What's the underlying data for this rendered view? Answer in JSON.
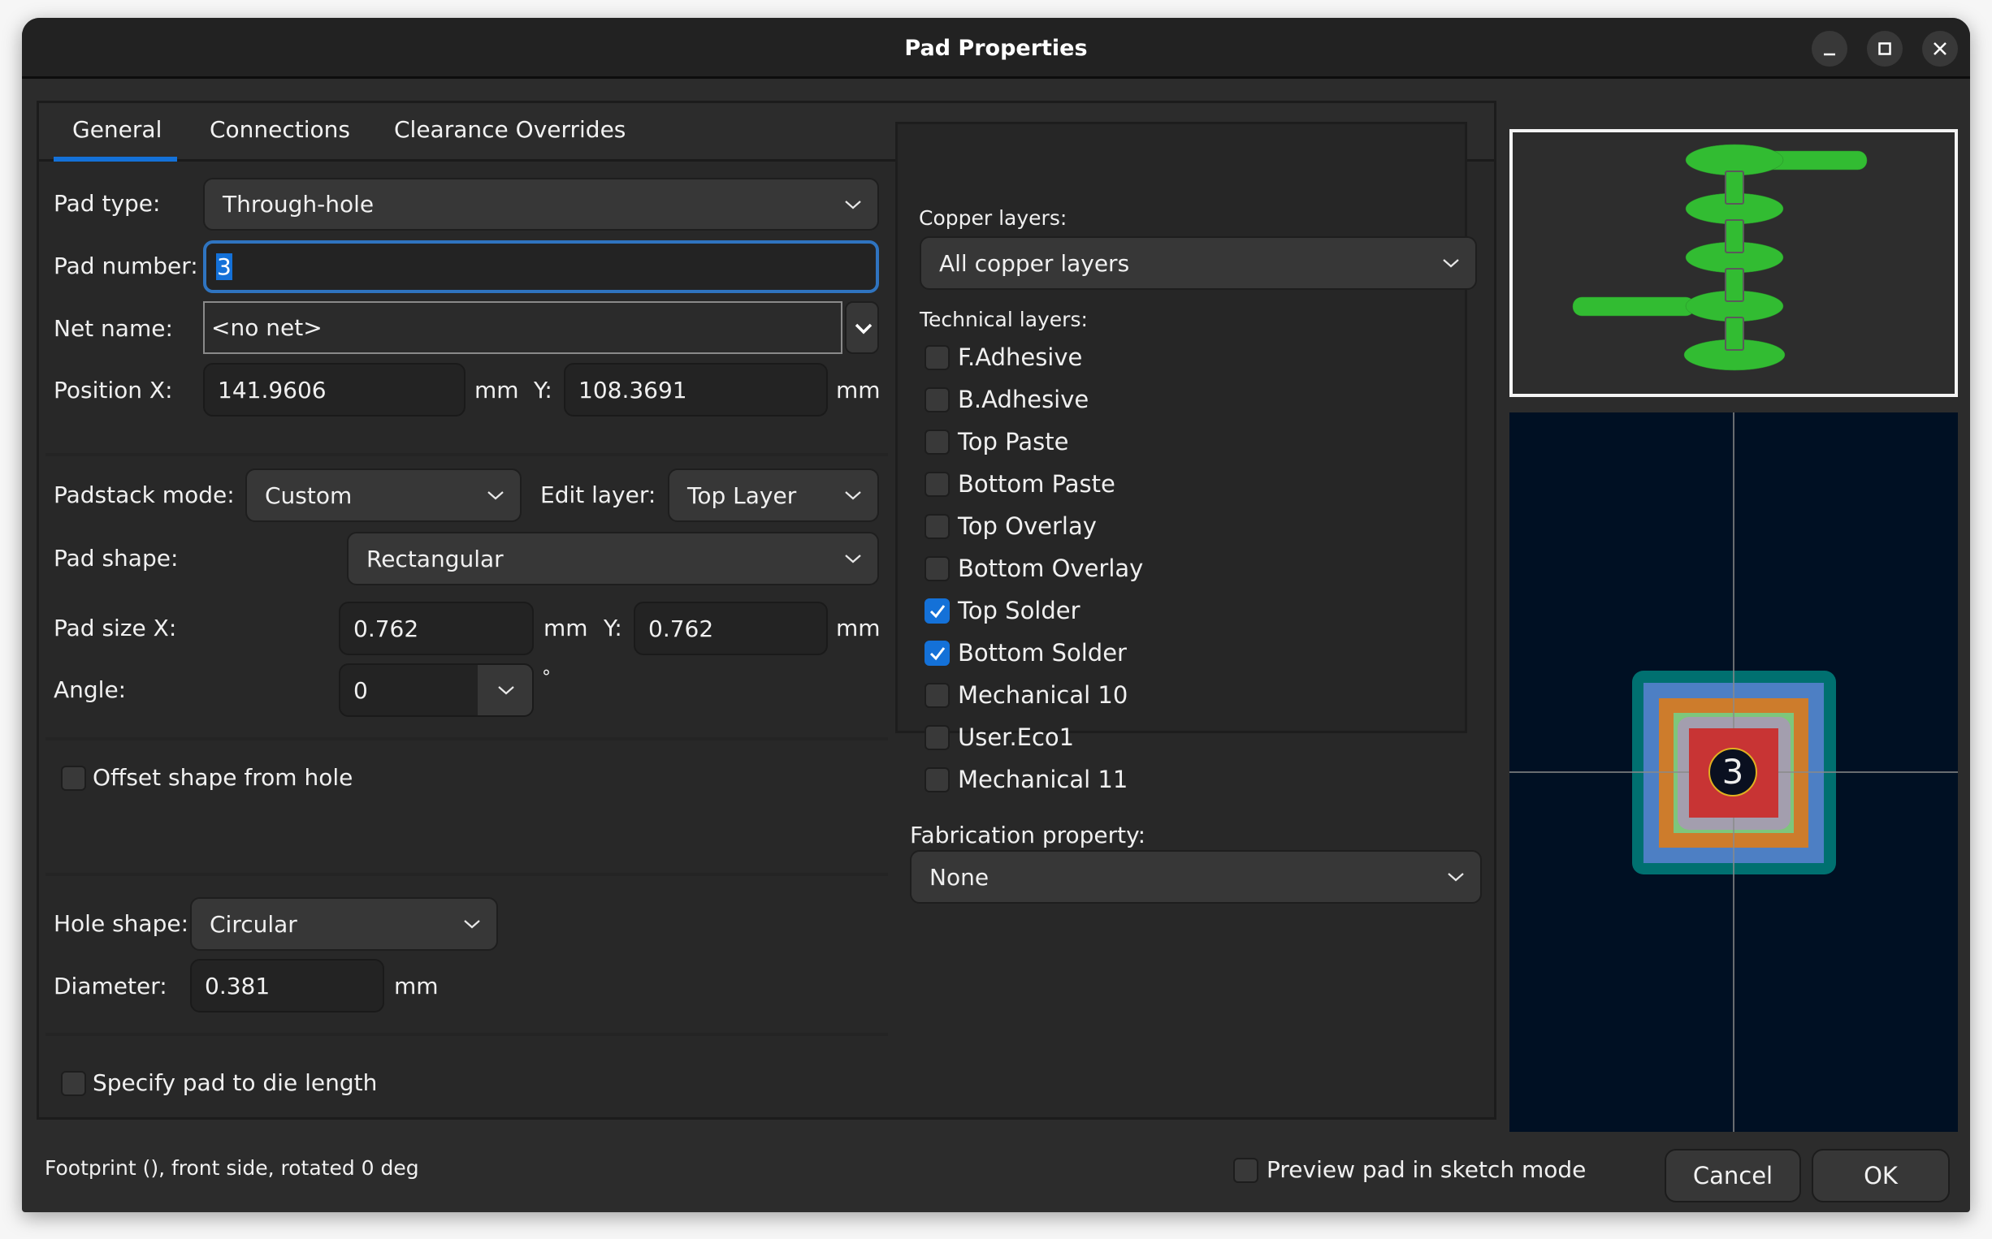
{
  "window": {
    "title": "Pad Properties",
    "controls": {
      "minimize": "minimize-icon",
      "maximize": "maximize-icon",
      "close": "close-icon"
    }
  },
  "tabs": [
    {
      "label": "General",
      "active": true
    },
    {
      "label": "Connections",
      "active": false
    },
    {
      "label": "Clearance Overrides",
      "active": false
    }
  ],
  "general": {
    "pad_type": {
      "label": "Pad type:",
      "value": "Through-hole"
    },
    "pad_number": {
      "label": "Pad number:",
      "value": "3"
    },
    "net_name": {
      "label": "Net name:",
      "value": "<no net>"
    },
    "position": {
      "label_x": "Position X:",
      "x": "141.9606",
      "unit_x": "mm",
      "label_y": "Y:",
      "y": "108.3691",
      "unit_y": "mm"
    },
    "padstack_mode": {
      "label": "Padstack mode:",
      "value": "Custom"
    },
    "edit_layer": {
      "label": "Edit layer:",
      "value": "Top Layer"
    },
    "pad_shape": {
      "label": "Pad shape:",
      "value": "Rectangular"
    },
    "pad_size": {
      "label_x": "Pad size X:",
      "x": "0.762",
      "unit_x": "mm",
      "label_y": "Y:",
      "y": "0.762",
      "unit_y": "mm"
    },
    "angle": {
      "label": "Angle:",
      "value": "0",
      "unit": "°"
    },
    "offset_shape": {
      "label": "Offset shape from hole",
      "checked": false
    },
    "hole_shape": {
      "label": "Hole shape:",
      "value": "Circular"
    },
    "diameter": {
      "label": "Diameter:",
      "value": "0.381",
      "unit": "mm"
    },
    "pad_to_die": {
      "label": "Specify pad to die length",
      "checked": false
    }
  },
  "layers": {
    "copper_label": "Copper layers:",
    "copper_value": "All copper layers",
    "technical_label": "Technical layers:",
    "technical": [
      {
        "label": "F.Adhesive",
        "checked": false
      },
      {
        "label": "B.Adhesive",
        "checked": false
      },
      {
        "label": "Top Paste",
        "checked": false
      },
      {
        "label": "Bottom Paste",
        "checked": false
      },
      {
        "label": "Top Overlay",
        "checked": false
      },
      {
        "label": "Bottom Overlay",
        "checked": false
      },
      {
        "label": "Top Solder",
        "checked": true
      },
      {
        "label": "Bottom Solder",
        "checked": true
      },
      {
        "label": "Mechanical 10",
        "checked": false
      },
      {
        "label": "User.Eco1",
        "checked": false
      },
      {
        "label": "Mechanical 11",
        "checked": false
      }
    ],
    "fabrication_label": "Fabrication property:",
    "fabrication_value": "None"
  },
  "preview": {
    "pad_number": "3",
    "colors": {
      "background": "#001023",
      "layer_teal": "#007070",
      "layer_blue": "#4d7fc4",
      "layer_orange": "#cd7c2c",
      "layer_green": "#7ec67c",
      "layer_gray": "#a39eae",
      "pad_red": "#c83434",
      "number_outline": "#e0b020",
      "padstack_icon_green": "#32bc32"
    }
  },
  "footer": {
    "status": "Footprint  (), front side, rotated 0 deg",
    "sketch_mode": {
      "label": "Preview pad in sketch mode",
      "checked": false
    },
    "cancel": "Cancel",
    "ok": "OK"
  },
  "colors": {
    "accent": "#1471d8",
    "focus_border": "#2f74c0"
  }
}
